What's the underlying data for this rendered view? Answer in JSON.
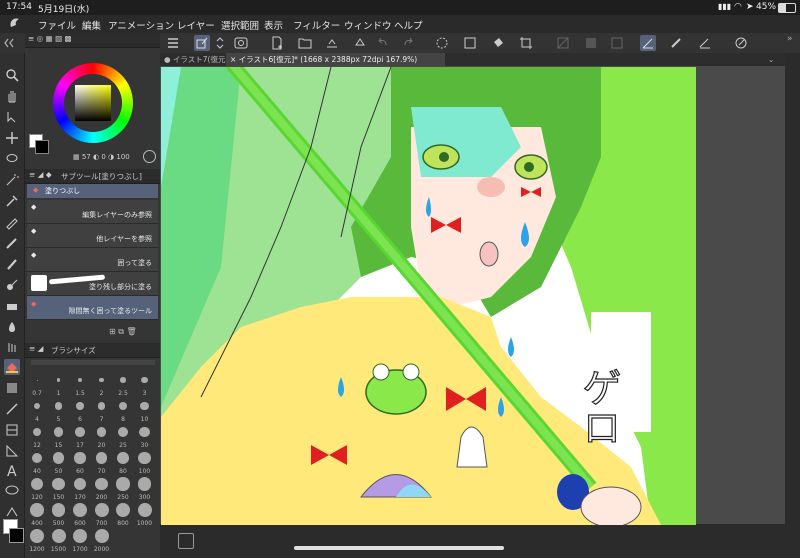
{
  "status_bar": {
    "time": "17:54",
    "date": "5月19日(水)",
    "battery": "45%"
  },
  "menu": [
    "ファイル",
    "編集",
    "アニメーション",
    "レイヤー",
    "選択範囲",
    "表示",
    "フィルター",
    "ウィンドウ",
    "ヘルプ"
  ],
  "tabs": [
    {
      "label": "イラスト7(復元"
    },
    {
      "label": "イラスト6[復元]* (1668 x 2388px 72dpi 167.9%)"
    }
  ],
  "color_panel": {
    "hue_value": "57",
    "sat_value": "0",
    "val_value": "100"
  },
  "subtool_panel": {
    "title": "サブツール[塗りつぶし]",
    "group_label": "塗りつぶし",
    "items": [
      {
        "label": "編集レイヤーのみ参照"
      },
      {
        "label": "他レイヤーを参照"
      },
      {
        "label": "囲って塗る"
      },
      {
        "label": "塗り残し部分に塗る"
      },
      {
        "label": "隙間無く囲って塗るツール"
      }
    ]
  },
  "brush_size_panel": {
    "title": "ブラシサイズ",
    "sizes": [
      "0.7",
      "1",
      "1.5",
      "2",
      "2.5",
      "3",
      "4",
      "5",
      "6",
      "7",
      "8",
      "10",
      "12",
      "15",
      "17",
      "20",
      "25",
      "30",
      "40",
      "50",
      "60",
      "70",
      "80",
      "100",
      "120",
      "150",
      "170",
      "200",
      "250",
      "300",
      "400",
      "500",
      "600",
      "700",
      "800",
      "1000",
      "1200",
      "1500",
      "1700",
      "2000"
    ]
  },
  "artwork": {
    "text": "ゲロ"
  },
  "colors": {
    "accent": "#55627a",
    "main_color": "#ffffff",
    "sub_color": "#000000",
    "artwork_green": "#8ae84a",
    "artwork_yellow": "#ffe97a"
  }
}
